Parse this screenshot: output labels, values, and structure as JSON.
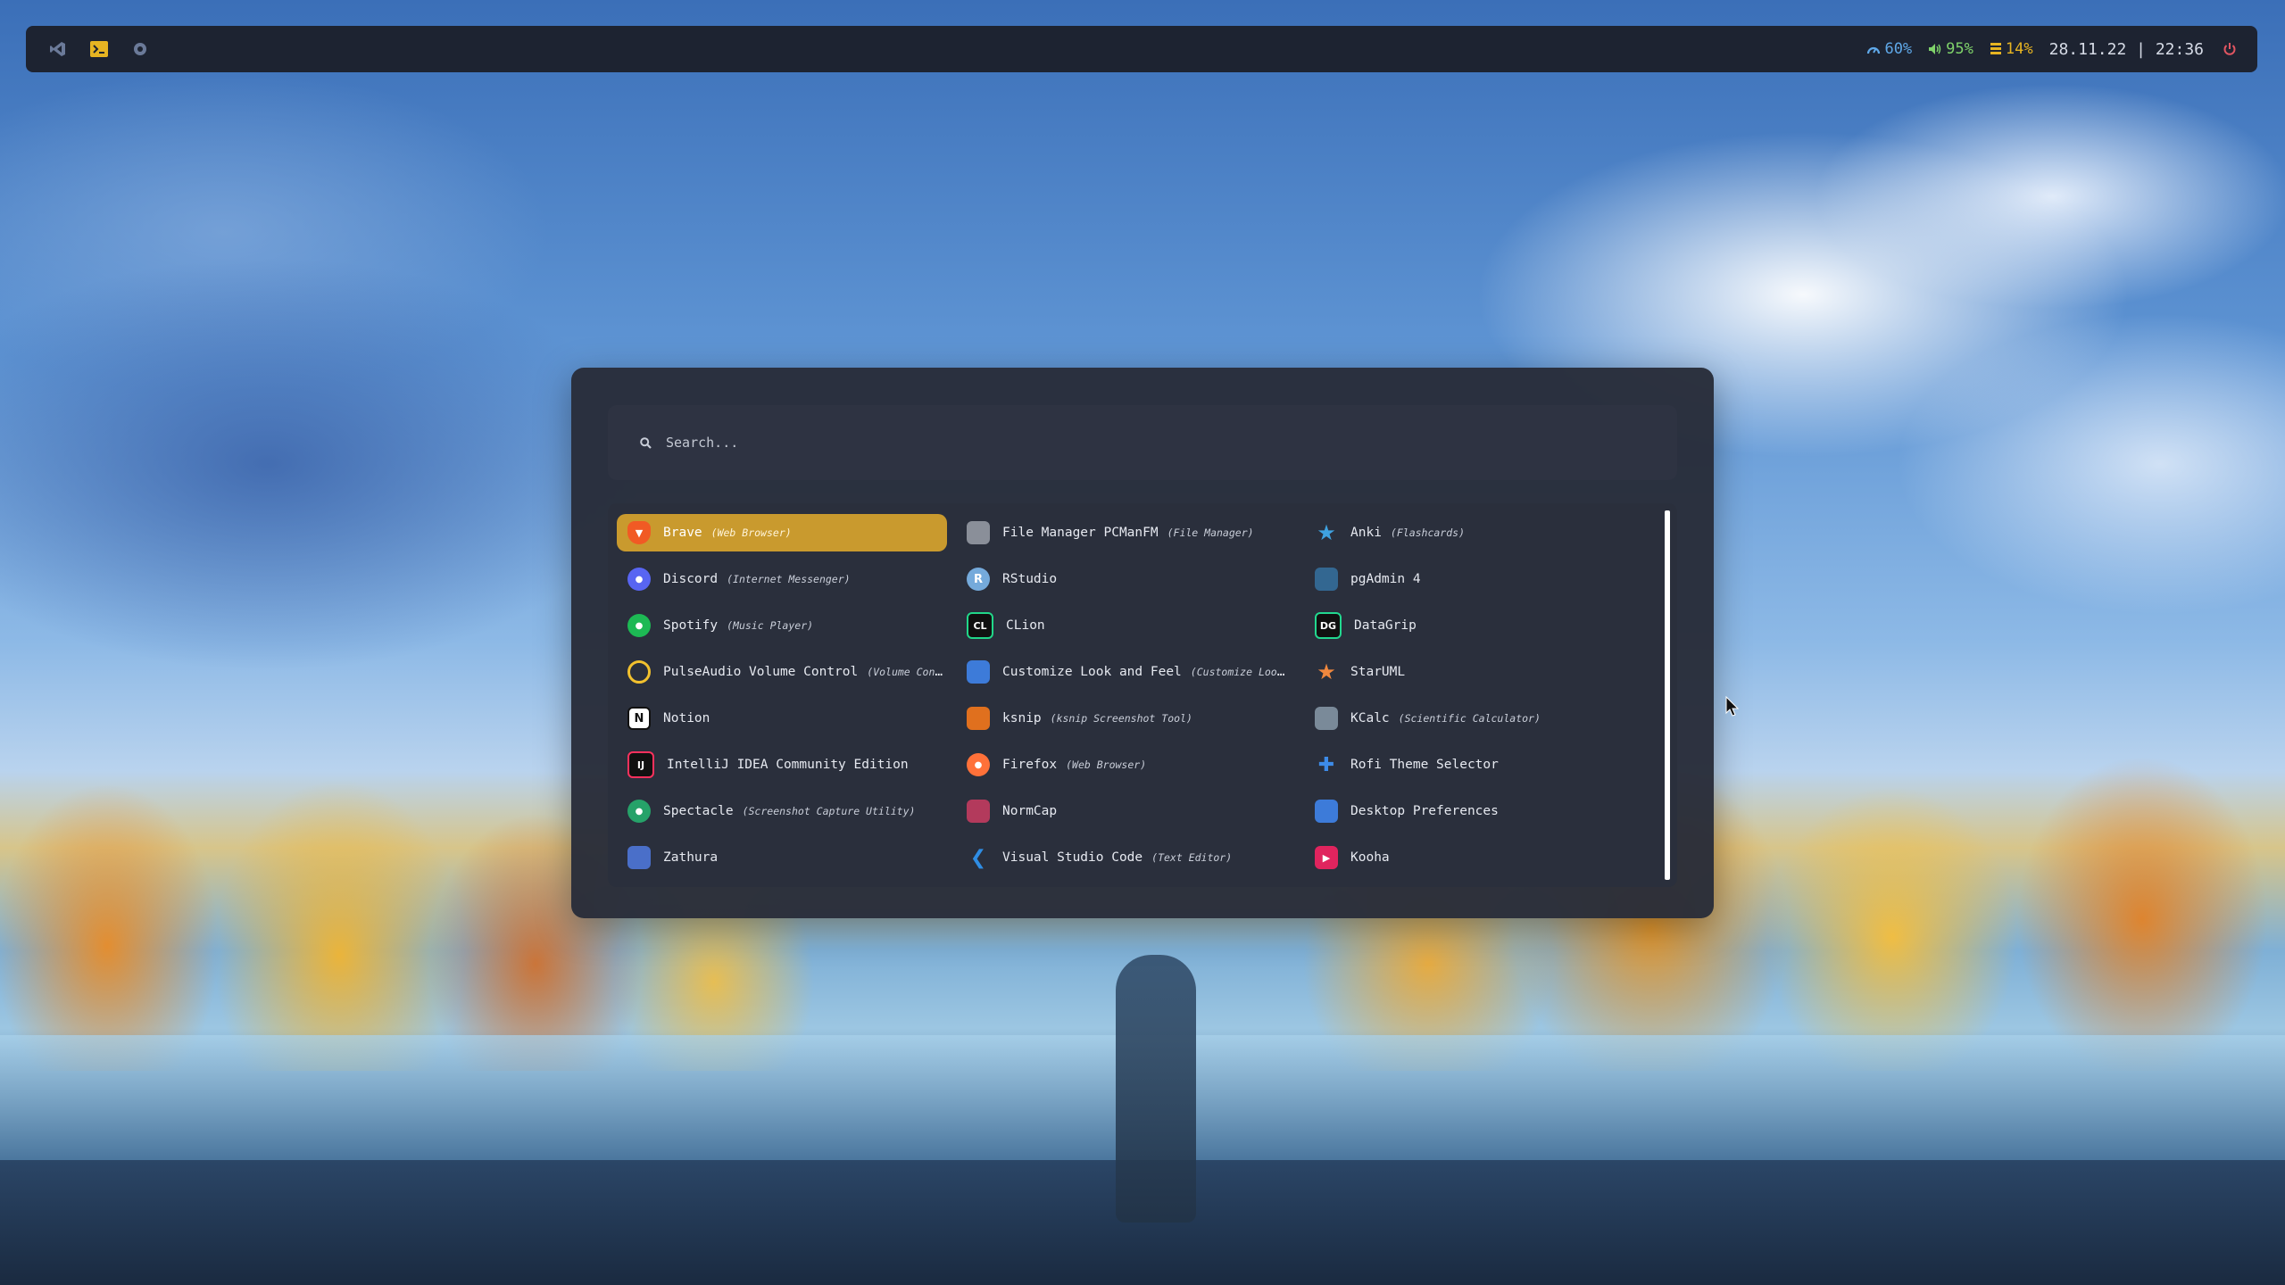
{
  "topbar": {
    "left_icons": [
      "vscode-icon",
      "terminal-icon",
      "circle-icon"
    ],
    "cpu": "60%",
    "volume": "95%",
    "battery": "14%",
    "datetime": "28.11.22 | 22:36"
  },
  "launcher": {
    "search_placeholder": "Search...",
    "columns": [
      [
        {
          "name": "Brave",
          "comment": "(Web Browser)",
          "icon": "brave-icon",
          "color": "#f15a24",
          "selected": true
        },
        {
          "name": "Discord",
          "comment": "(Internet Messenger)",
          "icon": "discord-icon",
          "color": "#5865f2"
        },
        {
          "name": "Spotify",
          "comment": "(Music Player)",
          "icon": "spotify-icon",
          "color": "#1db954"
        },
        {
          "name": "PulseAudio Volume Control",
          "comment": "(Volume Contro…",
          "icon": "pulseaudio-icon",
          "color": "#f2c12e"
        },
        {
          "name": "Notion",
          "comment": "",
          "icon": "notion-icon",
          "color": "#ffffff"
        },
        {
          "name": "IntelliJ IDEA Community Edition",
          "comment": "",
          "icon": "intellij-icon",
          "color": "#fe315d"
        },
        {
          "name": "Spectacle",
          "comment": "(Screenshot Capture Utility)",
          "icon": "spectacle-icon",
          "color": "#26a269"
        },
        {
          "name": "Zathura",
          "comment": "",
          "icon": "zathura-icon",
          "color": "#4a6fc9"
        }
      ],
      [
        {
          "name": "File Manager PCManFM",
          "comment": "(File Manager)",
          "icon": "file-manager-icon",
          "color": "#8a8f99"
        },
        {
          "name": "RStudio",
          "comment": "",
          "icon": "rstudio-icon",
          "color": "#75aadb"
        },
        {
          "name": "CLion",
          "comment": "",
          "icon": "clion-icon",
          "color": "#21d789"
        },
        {
          "name": "Customize Look and Feel",
          "comment": "(Customize Look …",
          "icon": "appearance-icon",
          "color": "#3d7bd9"
        },
        {
          "name": "ksnip",
          "comment": "(ksnip Screenshot Tool)",
          "icon": "ksnip-icon",
          "color": "#e0701e"
        },
        {
          "name": "Firefox",
          "comment": "(Web Browser)",
          "icon": "firefox-icon",
          "color": "#ff7139"
        },
        {
          "name": "NormCap",
          "comment": "",
          "icon": "normcap-icon",
          "color": "#b33a5c"
        },
        {
          "name": "Visual Studio Code",
          "comment": "(Text Editor)",
          "icon": "vscode-icon",
          "color": "#2f8de4"
        }
      ],
      [
        {
          "name": "Anki",
          "comment": "(Flashcards)",
          "icon": "anki-icon",
          "color": "#3fa2e0"
        },
        {
          "name": "pgAdmin 4",
          "comment": "",
          "icon": "pgadmin-icon",
          "color": "#336791"
        },
        {
          "name": "DataGrip",
          "comment": "",
          "icon": "datagrip-icon",
          "color": "#22d88f"
        },
        {
          "name": "StarUML",
          "comment": "",
          "icon": "staruml-icon",
          "color": "#f0883e"
        },
        {
          "name": "KCalc",
          "comment": "(Scientific Calculator)",
          "icon": "kcalc-icon",
          "color": "#7a8a99"
        },
        {
          "name": "Rofi Theme Selector",
          "comment": "",
          "icon": "puzzle-icon",
          "color": "#3d8be8"
        },
        {
          "name": "Desktop Preferences",
          "comment": "",
          "icon": "desktop-icon",
          "color": "#3d7bd9"
        },
        {
          "name": "Kooha",
          "comment": "",
          "icon": "kooha-icon",
          "color": "#e0245e"
        }
      ]
    ]
  }
}
